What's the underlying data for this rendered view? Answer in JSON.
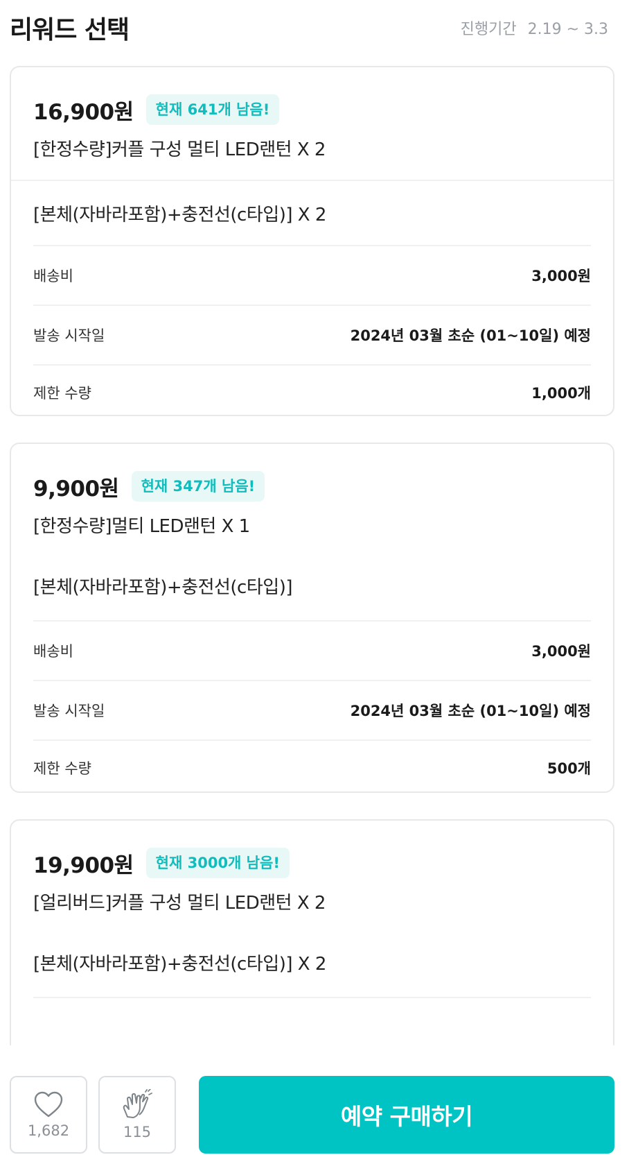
{
  "header": {
    "title": "리워드 선택",
    "period_label": "진행기간",
    "period_value": "2.19 ~ 3.3"
  },
  "rewards": [
    {
      "price": "16,900원",
      "badge": "현재 641개 남음!",
      "name": "[한정수량]커플 구성 멀티 LED랜턴 X 2",
      "option": "[본체(자바라포함)+충전선(c타입)] X 2",
      "rows": [
        {
          "label": "배송비",
          "value": "3,000원"
        },
        {
          "label": "발송 시작일",
          "value": "2024년 03월 초순 (01~10일) 예정"
        },
        {
          "label": "제한 수량",
          "value": "1,000개"
        }
      ]
    },
    {
      "price": "9,900원",
      "badge": "현재 347개 남음!",
      "name": "[한정수량]멀티 LED랜턴 X 1",
      "option": "[본체(자바라포함)+충전선(c타입)]",
      "rows": [
        {
          "label": "배송비",
          "value": "3,000원"
        },
        {
          "label": "발송 시작일",
          "value": "2024년 03월 초순 (01~10일) 예정"
        },
        {
          "label": "제한 수량",
          "value": "500개"
        }
      ]
    },
    {
      "price": "19,900원",
      "badge": "현재 3000개 남음!",
      "name": "[얼리버드]커플 구성 멀티 LED랜턴 X 2",
      "option": "[본체(자바라포함)+충전선(c타입)] X 2"
    }
  ],
  "bottom_bar": {
    "like_icon": "heart-icon",
    "like_count": "1,682",
    "cheer_icon": "clapping-hands-icon",
    "cheer_count": "115",
    "buy_label": "예약 구매하기"
  },
  "colors": {
    "accent": "#00c4c4",
    "badge_bg": "#e7f8f7",
    "badge_text": "#10bcbc",
    "border": "#e6e8ea"
  }
}
